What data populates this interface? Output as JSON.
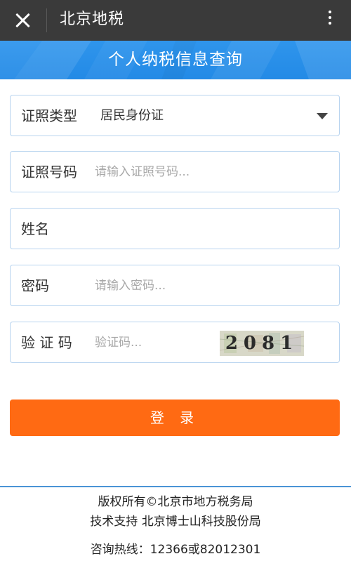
{
  "topbar": {
    "title": "北京地税",
    "close_icon": "close-icon",
    "more_icon": "more-vertical-icon"
  },
  "banner": {
    "title": "个人纳税信息查询",
    "color": "#2a90ea"
  },
  "form": {
    "id_type": {
      "label": "证照类型",
      "value": "居民身份证"
    },
    "id_number": {
      "label": "证照号码",
      "placeholder": "请输入证照号码..."
    },
    "name": {
      "label": "姓名",
      "placeholder": ""
    },
    "password": {
      "label": "密码",
      "placeholder": "请输入密码..."
    },
    "captcha": {
      "label": "验 证 码",
      "placeholder": "验证码...",
      "image_text": "2081"
    },
    "login_label": "登 录",
    "login_color": "#ff6a13"
  },
  "footer": {
    "copyright": "版权所有©北京市地方税务局",
    "tech_support": "技术支持 北京博士山科技股份局",
    "hotline": "咨询热线：12366或82012301"
  }
}
